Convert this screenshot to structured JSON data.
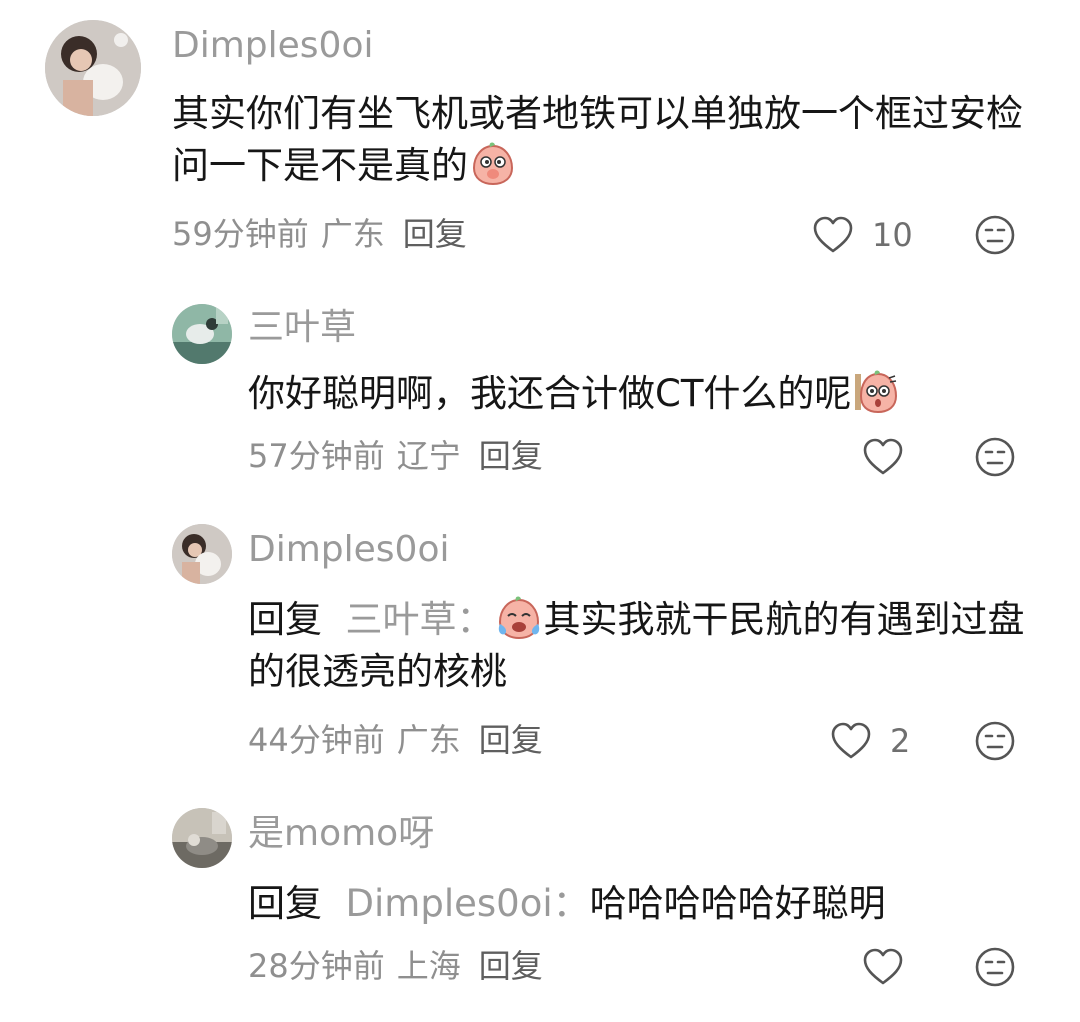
{
  "comments": [
    {
      "username": "Dimples0oi",
      "text": "其实你们有坐飞机或者地铁可以单独放一个框过安检问一下是不是真的",
      "time": "59分钟前",
      "location": "广东",
      "reply_label": "回复",
      "likes": "10"
    },
    {
      "username": "三叶草",
      "text": "你好聪明啊，我还合计做CT什么的呢",
      "time": "57分钟前",
      "location": "辽宁",
      "reply_label": "回复",
      "likes": ""
    },
    {
      "username": "Dimples0oi",
      "reply_prefix": "回复",
      "reply_to": "三叶草：",
      "text": "其实我就干民航的有遇到过盘的很透亮的核桃",
      "time": "44分钟前",
      "location": "广东",
      "reply_label": "回复",
      "likes": "2"
    },
    {
      "username": "是momo呀",
      "reply_prefix": "回复",
      "reply_to": "Dimples0oi：",
      "text": "哈哈哈哈哈好聪明",
      "time": "28分钟前",
      "location": "上海",
      "reply_label": "回复",
      "likes": ""
    }
  ],
  "icons": {
    "like": "heart-outline-icon",
    "dislike": "meh-face-icon",
    "emoji_1": "shy-peach-emoji",
    "emoji_2": "surprised-peach-emoji",
    "emoji_3": "crying-peach-emoji"
  },
  "colors": {
    "username": "#9a9a9a",
    "text": "#161616",
    "meta": "#8f8f8f"
  }
}
